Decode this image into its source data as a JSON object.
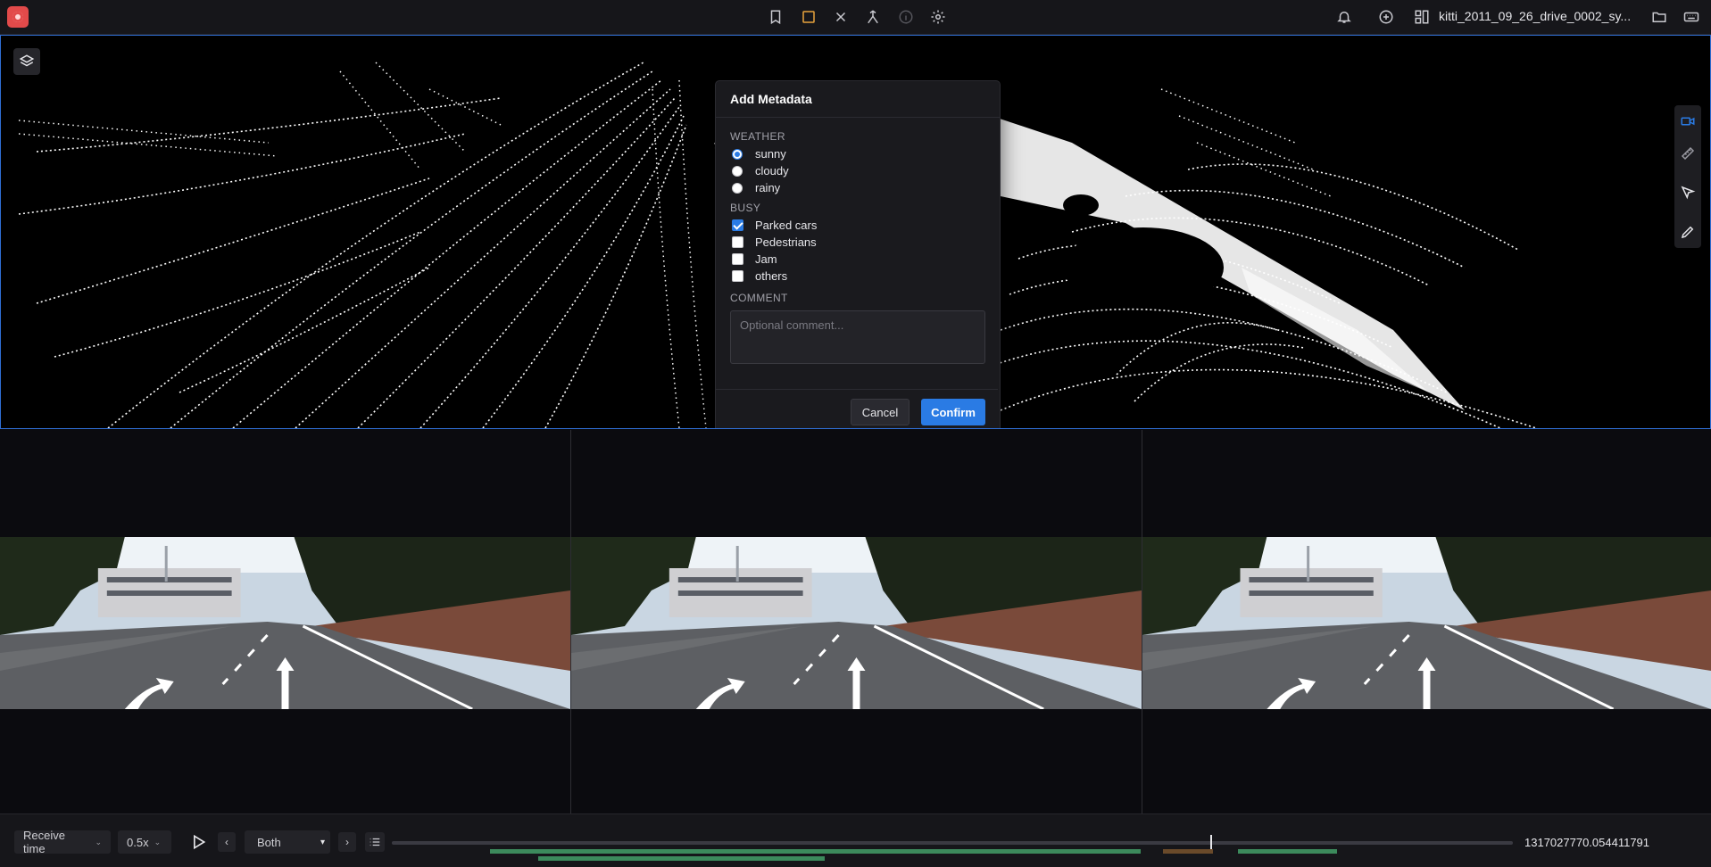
{
  "topbar": {
    "file_title": "kitti_2011_09_26_drive_0002_sy...",
    "center_icons": [
      "bookmark-icon",
      "square-icon",
      "close-icon",
      "merge-icon",
      "info-icon",
      "gear-icon"
    ],
    "right_icons": [
      "bell-icon",
      "plus-circle-icon",
      "layout-icon",
      "folder-open-icon",
      "keyboard-icon"
    ],
    "accent": "#e8a33c"
  },
  "modal": {
    "title": "Add Metadata",
    "weather_label": "WEATHER",
    "weather_options": [
      {
        "label": "sunny",
        "checked": true
      },
      {
        "label": "cloudy",
        "checked": false
      },
      {
        "label": "rainy",
        "checked": false
      }
    ],
    "busy_label": "BUSY",
    "busy_options": [
      {
        "label": "Parked cars",
        "checked": true
      },
      {
        "label": "Pedestrians",
        "checked": false
      },
      {
        "label": "Jam",
        "checked": false
      },
      {
        "label": "others",
        "checked": false
      }
    ],
    "comment_label": "COMMENT",
    "comment_placeholder": "Optional comment...",
    "cancel_label": "Cancel",
    "confirm_label": "Confirm",
    "confirm_color": "#2a7be4"
  },
  "side_tools": [
    "camera-icon",
    "ruler-icon",
    "cursor-icon",
    "pencil-icon"
  ],
  "playback": {
    "time_mode": "Receive time",
    "speed": "0.5x",
    "direction": "Both",
    "direction_options": [
      "Both"
    ],
    "timestamp": "1317027770.054411791",
    "progress": 0.727
  }
}
